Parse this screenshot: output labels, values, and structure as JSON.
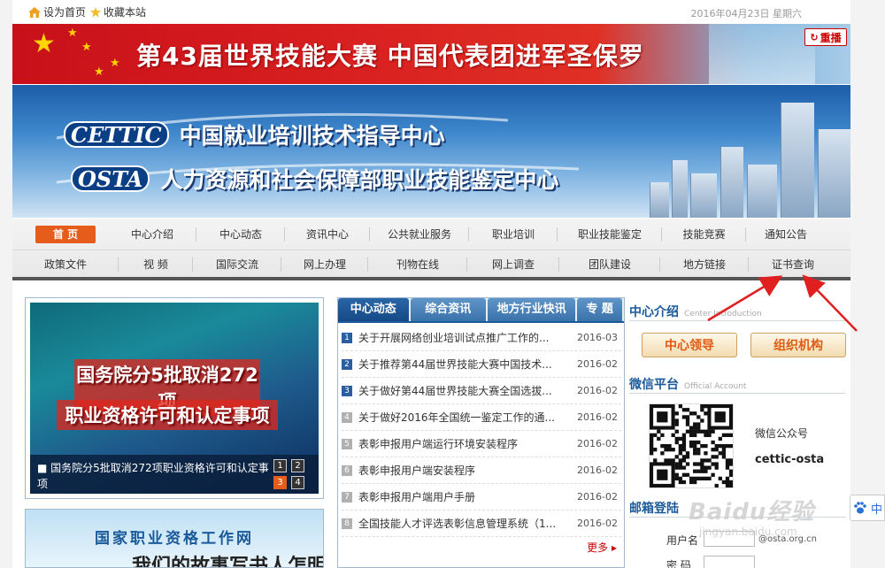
{
  "topbar": {
    "set_home": "设为首页",
    "bookmark": "收藏本站",
    "date": "2016年04月23日 星期六"
  },
  "banner_top": {
    "headline": "第43届世界技能大赛 中国代表团进军圣保罗",
    "review_button": "重播"
  },
  "masthead": {
    "logo1": "CETTIC",
    "title1": "中国就业培训技术指导中心",
    "logo2": "OSTA",
    "title2": "人力资源和社会保障部职业技能鉴定中心"
  },
  "nav": {
    "row1": [
      "首 页",
      "中心介绍",
      "中心动态",
      "资讯中心",
      "公共就业服务",
      "职业培训",
      "职业技能鉴定",
      "技能竞赛",
      "通知公告"
    ],
    "row2": [
      "政策文件",
      "视 频",
      "国际交流",
      "网上办理",
      "刊物在线",
      "网上调查",
      "团队建设",
      "地方链接",
      "证书查询"
    ]
  },
  "focus": {
    "headline_line1": "国务院分5批取消272项",
    "headline_line2": "职业资格许可和认定事项",
    "caption": "国务院分5批取消272项职业资格许可和认定事项",
    "pages": [
      "1",
      "2",
      "3",
      "4"
    ],
    "active_page": "3"
  },
  "promo": {
    "title": "国家职业资格工作网",
    "subtitle": "我们的故事写书人怎明了"
  },
  "news": {
    "tabs": [
      "中心动态",
      "综合资讯",
      "地方行业快讯",
      "专 题"
    ],
    "items": [
      {
        "num": "1",
        "title": "关于开展网络创业培训试点推广工作的...",
        "date": "2016-03"
      },
      {
        "num": "2",
        "title": "关于推荐第44届世界技能大赛中国技术...",
        "date": "2016-02"
      },
      {
        "num": "3",
        "title": "关于做好第44届世界技能大赛全国选拔...",
        "date": "2016-02"
      },
      {
        "num": "4",
        "title": "关于做好2016年全国统一鉴定工作的通...",
        "date": "2016-02"
      },
      {
        "num": "5",
        "title": "表彰申报用户端运行环境安装程序",
        "date": "2016-02"
      },
      {
        "num": "6",
        "title": "表彰申报用户端安装程序",
        "date": "2016-02"
      },
      {
        "num": "7",
        "title": "表彰申报用户端用户手册",
        "date": "2016-02"
      },
      {
        "num": "8",
        "title": "全国技能人才评选表彰信息管理系统（1...",
        "date": "2016-02"
      }
    ],
    "more": "更多"
  },
  "side": {
    "intro_title": "中心介绍",
    "intro_en": "Center Introduction",
    "leaders_button": "中心领导",
    "org_button": "组织机构",
    "wechat_title": "微信平台",
    "wechat_en": "Official Account",
    "wechat_label": "微信公众号",
    "wechat_id": "cettic-osta",
    "mail_title": "邮箱登陆",
    "username_label": "用户名",
    "username_suffix": "@osta.org.cn",
    "password_label": "密 码"
  },
  "watermark": {
    "text": "Baidu经验",
    "sub": "jingyan.baidu.com"
  },
  "float_label": "中",
  "colors": {
    "nav_home": "#e65c1a",
    "tab_blue": "#1a5a9a",
    "annotation_red": "#e02020"
  }
}
